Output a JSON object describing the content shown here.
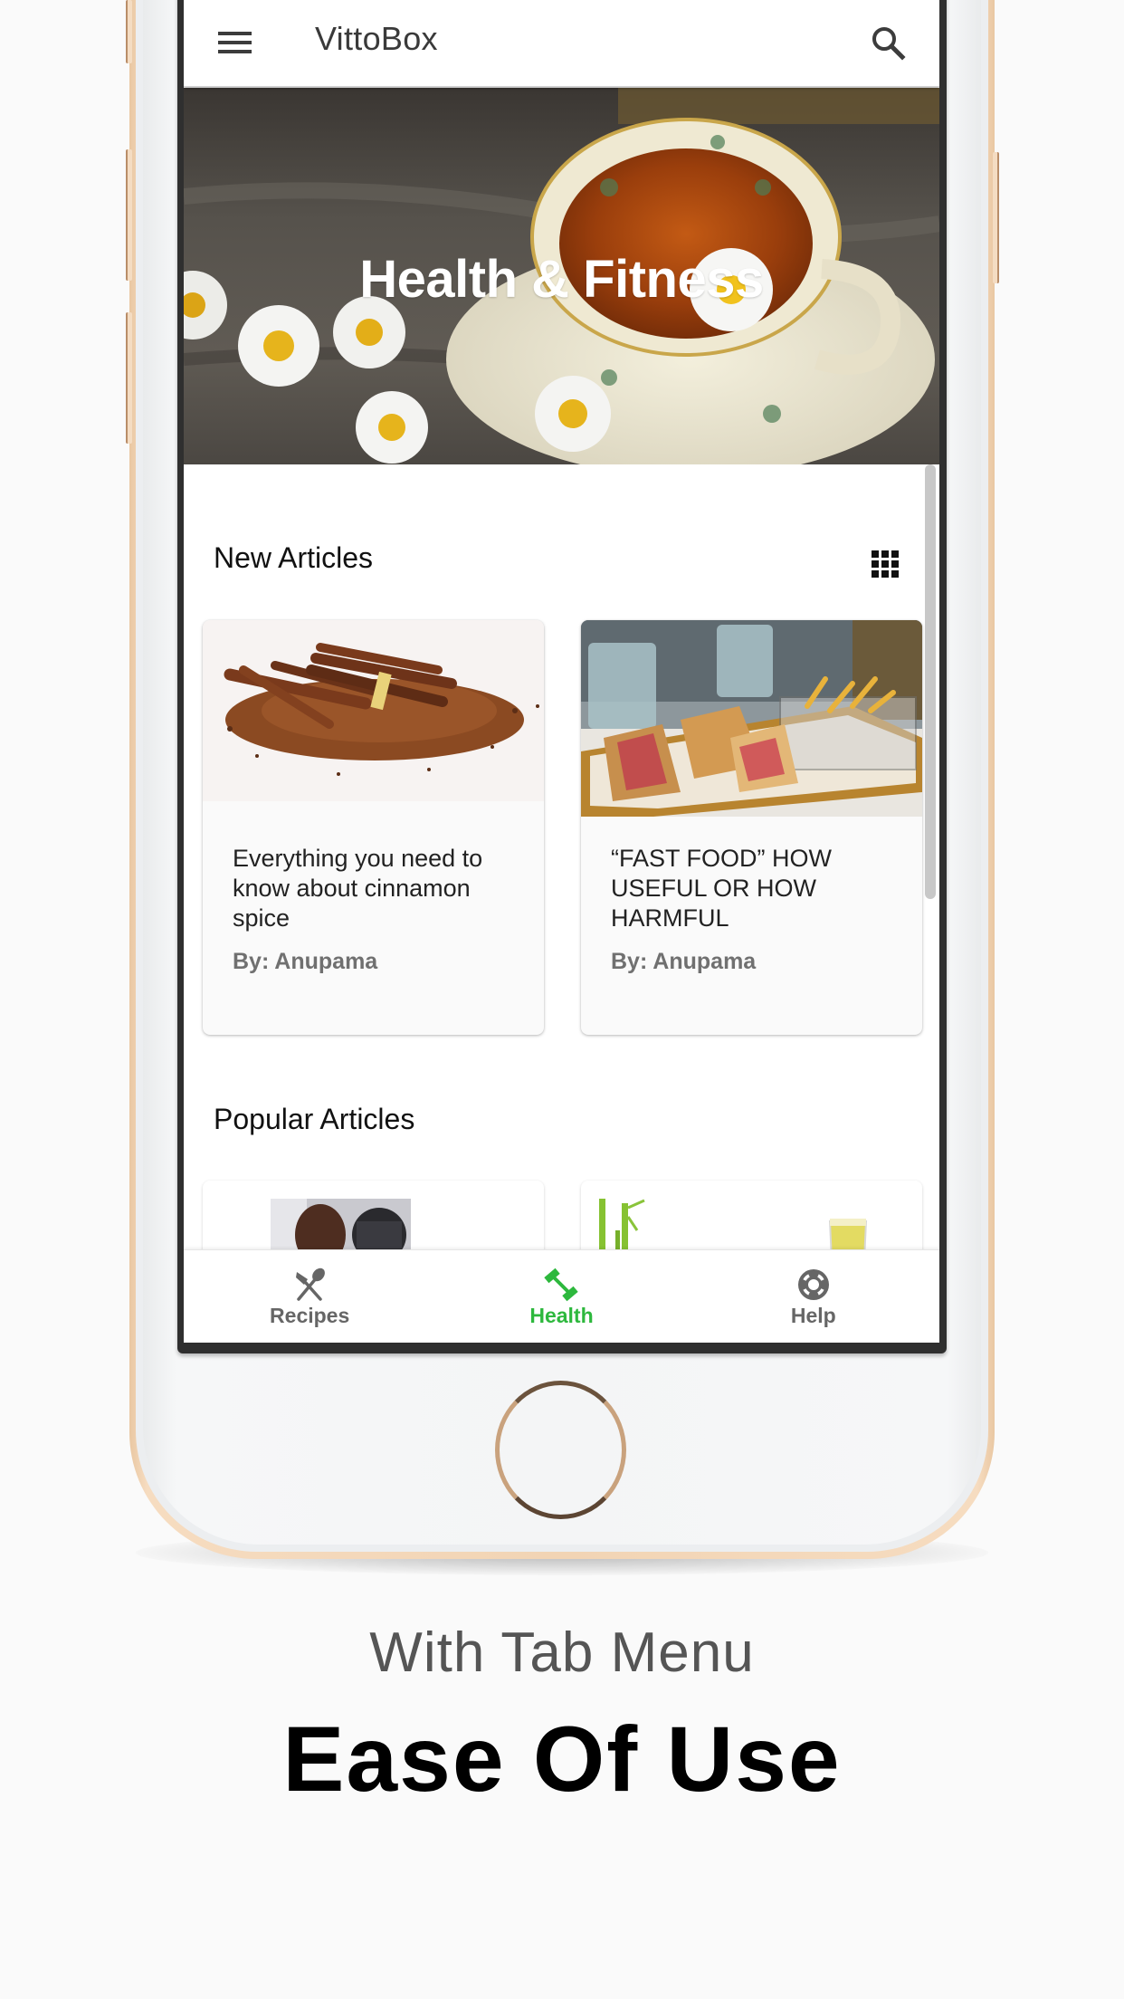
{
  "app": {
    "title": "VittoBox",
    "icons": {
      "menu": "hamburger-menu-icon",
      "search": "search-icon",
      "view_toggle": "grid-view-icon"
    }
  },
  "hero": {
    "title": "Health & Fitness"
  },
  "sections": {
    "new_articles": {
      "title": "New Articles",
      "cards": [
        {
          "title": "Everything you need to know about cinnamon spice",
          "author": "By: Anupama",
          "image": "cinnamon-sticks-and-powder"
        },
        {
          "title": "“FAST FOOD” HOW USEFUL OR HOW HARMFUL",
          "author": "By: Anupama",
          "image": "club-sandwich-and-fries-tray"
        }
      ]
    },
    "popular_articles": {
      "title": "Popular Articles",
      "cards": [
        {
          "image": "man-lifting-dumbbell"
        },
        {
          "image": "bamboo-and-juice-glass"
        }
      ]
    }
  },
  "bottom_nav": {
    "active_color": "#2db83d",
    "inactive_color": "#666666",
    "items": [
      {
        "label": "Recipes",
        "icon": "fork-spoon-icon",
        "active": false
      },
      {
        "label": "Health",
        "icon": "dumbbell-icon",
        "active": true
      },
      {
        "label": "Help",
        "icon": "lifebuoy-icon",
        "active": false
      }
    ]
  },
  "caption": {
    "subtitle": "With Tab Menu",
    "headline": "Ease Of Use"
  }
}
